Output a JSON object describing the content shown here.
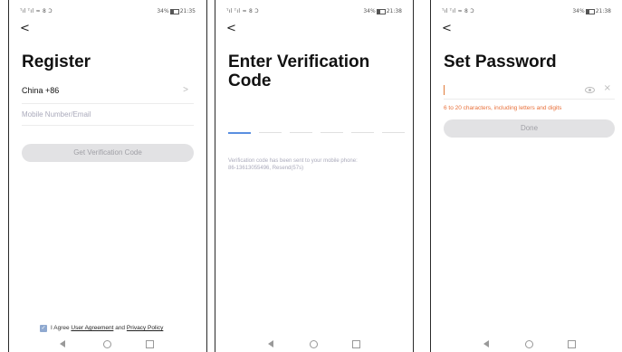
{
  "status": {
    "signal": "\"      ",
    "p1": {
      "left": "ᵀıl ᵀıl ≈ 8 Ɔ",
      "battery_pct": "34%",
      "time": "21:35"
    },
    "p2": {
      "left": "ᵀıl ᵀıl ≈ 8 Ɔ",
      "battery_pct": "34%",
      "time": "21:38"
    },
    "p3": {
      "left": "ᵀıl ᵀıl ≈ 8 Ɔ",
      "battery_pct": "34%",
      "time": "21:38"
    }
  },
  "icons": {
    "back": "back-arrow-icon",
    "chevron": "chevron-right-icon",
    "eye": "eye-icon",
    "close": "close-icon",
    "check": "checkbox-icon"
  },
  "register": {
    "back_glyph": "<",
    "title": "Register",
    "country": "China +86",
    "chevron_glyph": ">",
    "mobile_placeholder": "Mobile Number/Email",
    "get_code_button": "Get Verification Code",
    "check_glyph": "✓",
    "agree_prefix": "I Agree",
    "user_agreement": "User Agreement",
    "and": "and",
    "privacy_policy": "Privacy Policy"
  },
  "verify": {
    "back_glyph": "<",
    "title_line1": "Enter Verification",
    "title_line2": "Code",
    "code_length": 6,
    "info_line1": "Verification code has been sent to your mobile phone:",
    "info_line2": "86-13613055496, Resend(57s)"
  },
  "password": {
    "back_glyph": "<",
    "title": "Set Password",
    "close_glyph": "×",
    "hint": "6 to 20 characters, including letters and digits",
    "done_button": "Done"
  },
  "colors": {
    "accent": "#5a8fe0",
    "hint": "#e8703a",
    "button_disabled_bg": "#e2e2e4",
    "button_disabled_text": "#a0a0a6"
  }
}
